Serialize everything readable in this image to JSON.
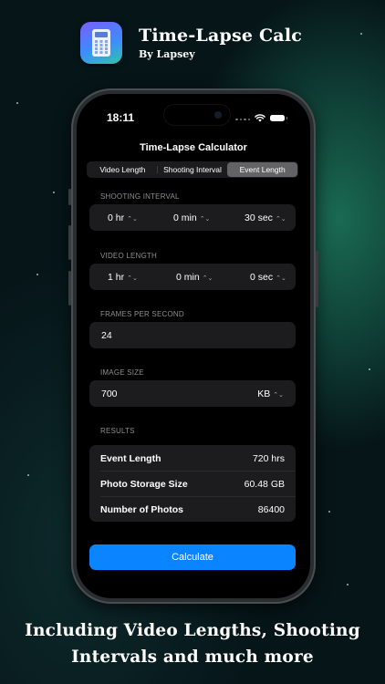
{
  "header": {
    "app_name": "Time-Lapse Calc",
    "developer": "By Lapsey",
    "icon": "calculator-icon"
  },
  "status_bar": {
    "time": "18:11",
    "icons": [
      "cellular-signal-icon",
      "wifi-icon",
      "battery-icon"
    ]
  },
  "screen": {
    "title": "Time-Lapse Calculator",
    "tabs": [
      {
        "label": "Video Length",
        "selected": false
      },
      {
        "label": "Shooting Interval",
        "selected": false
      },
      {
        "label": "Event Length",
        "selected": true
      }
    ],
    "shooting_interval": {
      "label": "SHOOTING INTERVAL",
      "hours": "0 hr",
      "minutes": "0 min",
      "seconds": "30 sec"
    },
    "video_length": {
      "label": "VIDEO LENGTH",
      "hours": "1 hr",
      "minutes": "0 min",
      "seconds": "0 sec"
    },
    "fps": {
      "label": "FRAMES PER SECOND",
      "value": "24"
    },
    "image_size": {
      "label": "IMAGE SIZE",
      "value": "700",
      "unit": "KB"
    },
    "results": {
      "label": "RESULTS",
      "rows": [
        {
          "key": "Event Length",
          "value": "720 hrs"
        },
        {
          "key": "Photo Storage Size",
          "value": "60.48 GB"
        },
        {
          "key": "Number of Photos",
          "value": "86400"
        }
      ]
    },
    "calculate_label": "Calculate"
  },
  "caption": {
    "line1": "Including Video Lengths, Shooting",
    "line2": "Intervals and much more"
  },
  "colors": {
    "accent": "#0a84ff",
    "background": "#061518",
    "card": "#1c1c1e"
  }
}
